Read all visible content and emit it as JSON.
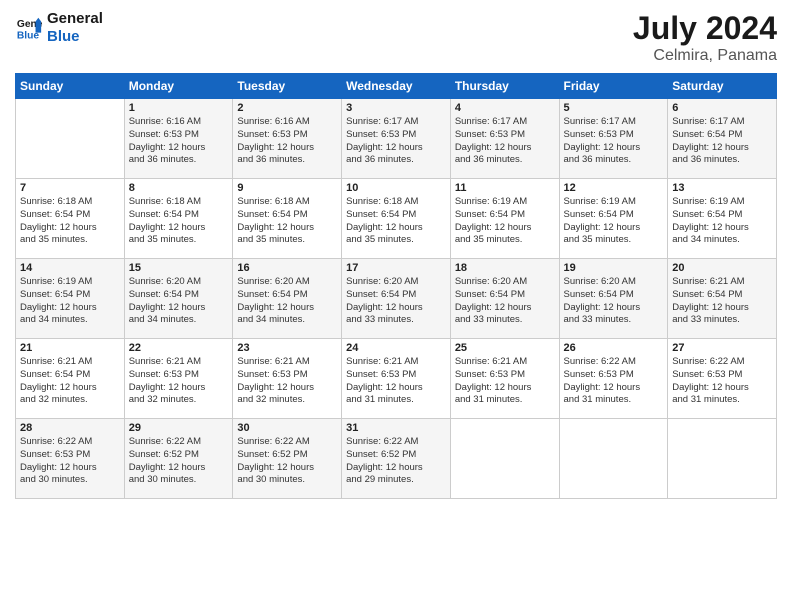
{
  "header": {
    "logo_line1": "General",
    "logo_line2": "Blue",
    "month": "July 2024",
    "location": "Celmira, Panama"
  },
  "days_of_week": [
    "Sunday",
    "Monday",
    "Tuesday",
    "Wednesday",
    "Thursday",
    "Friday",
    "Saturday"
  ],
  "weeks": [
    [
      {
        "num": "",
        "detail": ""
      },
      {
        "num": "1",
        "detail": "Sunrise: 6:16 AM\nSunset: 6:53 PM\nDaylight: 12 hours\nand 36 minutes."
      },
      {
        "num": "2",
        "detail": "Sunrise: 6:16 AM\nSunset: 6:53 PM\nDaylight: 12 hours\nand 36 minutes."
      },
      {
        "num": "3",
        "detail": "Sunrise: 6:17 AM\nSunset: 6:53 PM\nDaylight: 12 hours\nand 36 minutes."
      },
      {
        "num": "4",
        "detail": "Sunrise: 6:17 AM\nSunset: 6:53 PM\nDaylight: 12 hours\nand 36 minutes."
      },
      {
        "num": "5",
        "detail": "Sunrise: 6:17 AM\nSunset: 6:53 PM\nDaylight: 12 hours\nand 36 minutes."
      },
      {
        "num": "6",
        "detail": "Sunrise: 6:17 AM\nSunset: 6:54 PM\nDaylight: 12 hours\nand 36 minutes."
      }
    ],
    [
      {
        "num": "7",
        "detail": "Sunrise: 6:18 AM\nSunset: 6:54 PM\nDaylight: 12 hours\nand 35 minutes."
      },
      {
        "num": "8",
        "detail": "Sunrise: 6:18 AM\nSunset: 6:54 PM\nDaylight: 12 hours\nand 35 minutes."
      },
      {
        "num": "9",
        "detail": "Sunrise: 6:18 AM\nSunset: 6:54 PM\nDaylight: 12 hours\nand 35 minutes."
      },
      {
        "num": "10",
        "detail": "Sunrise: 6:18 AM\nSunset: 6:54 PM\nDaylight: 12 hours\nand 35 minutes."
      },
      {
        "num": "11",
        "detail": "Sunrise: 6:19 AM\nSunset: 6:54 PM\nDaylight: 12 hours\nand 35 minutes."
      },
      {
        "num": "12",
        "detail": "Sunrise: 6:19 AM\nSunset: 6:54 PM\nDaylight: 12 hours\nand 35 minutes."
      },
      {
        "num": "13",
        "detail": "Sunrise: 6:19 AM\nSunset: 6:54 PM\nDaylight: 12 hours\nand 34 minutes."
      }
    ],
    [
      {
        "num": "14",
        "detail": "Sunrise: 6:19 AM\nSunset: 6:54 PM\nDaylight: 12 hours\nand 34 minutes."
      },
      {
        "num": "15",
        "detail": "Sunrise: 6:20 AM\nSunset: 6:54 PM\nDaylight: 12 hours\nand 34 minutes."
      },
      {
        "num": "16",
        "detail": "Sunrise: 6:20 AM\nSunset: 6:54 PM\nDaylight: 12 hours\nand 34 minutes."
      },
      {
        "num": "17",
        "detail": "Sunrise: 6:20 AM\nSunset: 6:54 PM\nDaylight: 12 hours\nand 33 minutes."
      },
      {
        "num": "18",
        "detail": "Sunrise: 6:20 AM\nSunset: 6:54 PM\nDaylight: 12 hours\nand 33 minutes."
      },
      {
        "num": "19",
        "detail": "Sunrise: 6:20 AM\nSunset: 6:54 PM\nDaylight: 12 hours\nand 33 minutes."
      },
      {
        "num": "20",
        "detail": "Sunrise: 6:21 AM\nSunset: 6:54 PM\nDaylight: 12 hours\nand 33 minutes."
      }
    ],
    [
      {
        "num": "21",
        "detail": "Sunrise: 6:21 AM\nSunset: 6:54 PM\nDaylight: 12 hours\nand 32 minutes."
      },
      {
        "num": "22",
        "detail": "Sunrise: 6:21 AM\nSunset: 6:53 PM\nDaylight: 12 hours\nand 32 minutes."
      },
      {
        "num": "23",
        "detail": "Sunrise: 6:21 AM\nSunset: 6:53 PM\nDaylight: 12 hours\nand 32 minutes."
      },
      {
        "num": "24",
        "detail": "Sunrise: 6:21 AM\nSunset: 6:53 PM\nDaylight: 12 hours\nand 31 minutes."
      },
      {
        "num": "25",
        "detail": "Sunrise: 6:21 AM\nSunset: 6:53 PM\nDaylight: 12 hours\nand 31 minutes."
      },
      {
        "num": "26",
        "detail": "Sunrise: 6:22 AM\nSunset: 6:53 PM\nDaylight: 12 hours\nand 31 minutes."
      },
      {
        "num": "27",
        "detail": "Sunrise: 6:22 AM\nSunset: 6:53 PM\nDaylight: 12 hours\nand 31 minutes."
      }
    ],
    [
      {
        "num": "28",
        "detail": "Sunrise: 6:22 AM\nSunset: 6:53 PM\nDaylight: 12 hours\nand 30 minutes."
      },
      {
        "num": "29",
        "detail": "Sunrise: 6:22 AM\nSunset: 6:52 PM\nDaylight: 12 hours\nand 30 minutes."
      },
      {
        "num": "30",
        "detail": "Sunrise: 6:22 AM\nSunset: 6:52 PM\nDaylight: 12 hours\nand 30 minutes."
      },
      {
        "num": "31",
        "detail": "Sunrise: 6:22 AM\nSunset: 6:52 PM\nDaylight: 12 hours\nand 29 minutes."
      },
      {
        "num": "",
        "detail": ""
      },
      {
        "num": "",
        "detail": ""
      },
      {
        "num": "",
        "detail": ""
      }
    ]
  ]
}
